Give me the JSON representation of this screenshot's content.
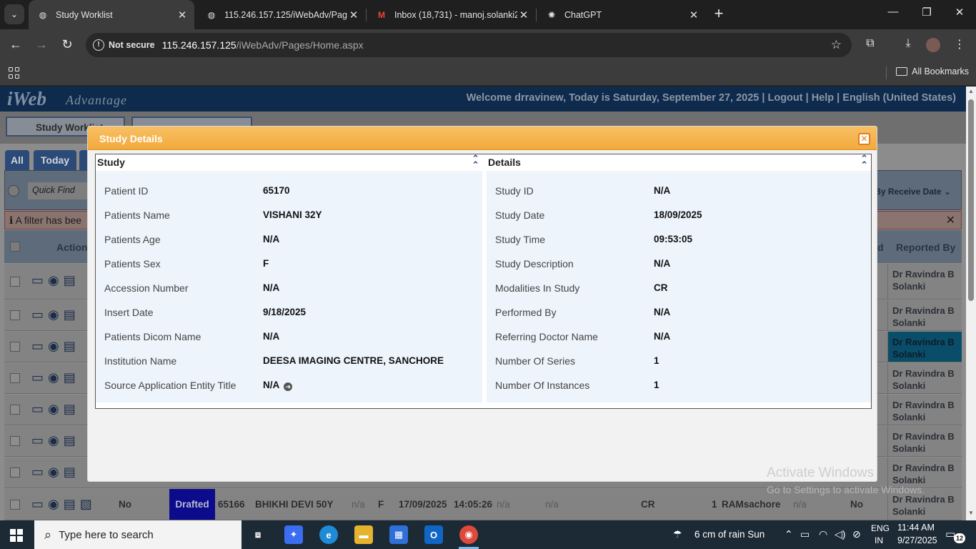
{
  "browser": {
    "tabs": [
      {
        "title": "Study Worklist",
        "active": true
      },
      {
        "title": "115.246.157.125/iWebAdv/Page",
        "active": false
      },
      {
        "title": "Inbox (18,731) - manoj.solanki2",
        "active": false
      },
      {
        "title": "ChatGPT",
        "active": false
      }
    ],
    "security_chip": "Not secure",
    "url_host": "115.246.157.125",
    "url_path": "/iWebAdv/Pages/Home.aspx",
    "all_bookmarks": "All Bookmarks"
  },
  "app": {
    "logo": "iWeb",
    "logo_sub": "Advantage",
    "welcome": "Welcome drravinew, Today is Saturday, September 27, 2025",
    "logout": "Logout",
    "help": "Help",
    "language": "English (United States)",
    "nav_tab_1": "Study Worklist",
    "filter_tabs": [
      "All",
      "Today"
    ],
    "quick_find_placeholder": "Quick Find",
    "sort_label": "By Receive Date",
    "filter_note": "A filter has bee",
    "grid_actions_header": "Action",
    "grid_d_header": "d",
    "grid_reported_header": "Reported By",
    "reported_by": "Dr Ravindra B Solanki",
    "last_row": {
      "printed": "No",
      "status": "Drafted",
      "patient_id": "65166",
      "patient_name": "BHIKHI DEVI 50Y",
      "age": "n/a",
      "sex": "F",
      "study_date": "17/09/2025",
      "study_time": "14:05:26",
      "col_a": "n/a",
      "col_b": "n/a",
      "modality": "CR",
      "count": "1",
      "institution": "RAMsachore",
      "col_c": "n/a",
      "col_d": "No"
    }
  },
  "modal": {
    "title": "Study Details",
    "study_panel": {
      "heading": "Study",
      "fields": [
        {
          "label": "Patient ID",
          "value": "65170"
        },
        {
          "label": "Patients Name",
          "value": "VISHANI 32Y"
        },
        {
          "label": "Patients Age",
          "value": "N/A"
        },
        {
          "label": "Patients Sex",
          "value": "F"
        },
        {
          "label": "Accession Number",
          "value": "N/A"
        },
        {
          "label": "Insert Date",
          "value": "9/18/2025"
        },
        {
          "label": "Patients Dicom Name",
          "value": "N/A"
        },
        {
          "label": "Institution Name",
          "value": "DEESA IMAGING CENTRE, SANCHORE"
        },
        {
          "label": "Source Application Entity Title",
          "value": "N/A"
        }
      ]
    },
    "details_panel": {
      "heading": "Details",
      "fields": [
        {
          "label": "Study ID",
          "value": "N/A"
        },
        {
          "label": "Study Date",
          "value": "18/09/2025"
        },
        {
          "label": "Study Time",
          "value": "09:53:05"
        },
        {
          "label": "Study Description",
          "value": "N/A"
        },
        {
          "label": "Modalities In Study",
          "value": "CR"
        },
        {
          "label": "Performed By",
          "value": "N/A"
        },
        {
          "label": "Referring Doctor Name",
          "value": "N/A"
        },
        {
          "label": "Number Of Series",
          "value": "1"
        },
        {
          "label": "Number Of Instances",
          "value": "1"
        }
      ]
    }
  },
  "watermark": {
    "line1": "Activate Windows",
    "line2": "Go to Settings to activate Windows."
  },
  "taskbar": {
    "search_placeholder": "Type here to search",
    "weather": "6 cm of rain Sun",
    "lang_1": "ENG",
    "lang_2": "IN",
    "time": "11:44 AM",
    "date": "9/27/2025",
    "notifications": "12"
  },
  "colors": {
    "modal_title_bar": "#f2a93c",
    "app_header": "#0e2a4c",
    "drafted_badge": "#0b0b8c"
  }
}
